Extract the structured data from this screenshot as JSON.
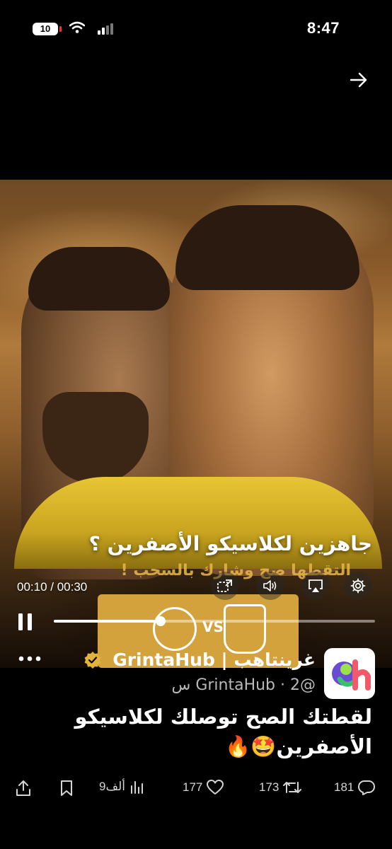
{
  "status_bar": {
    "battery": "10",
    "time": "8:47"
  },
  "media": {
    "headline": "جاهزين لكلاسيكو الأصفرين ؟",
    "subheadline": "التقطها صح وشارك بالسحب !",
    "ticket": {
      "vs": "VS"
    },
    "video": {
      "time_label": "00:10 / 00:30",
      "progress_fraction": 0.333
    }
  },
  "tweet": {
    "display_name": "غرينتاهب | GrintaHub",
    "handle_line": "@GrintaHub · 2 س",
    "text_line1": "لقطتك الصح توصلك لكلاسيكو",
    "text_line2": "الأصفرين🤩🔥",
    "actions": {
      "replies": "181",
      "reposts": "173",
      "likes": "177",
      "views": "9ألف"
    }
  },
  "icons": {
    "share_arrow": "arrow-right-icon",
    "more": "more-dots-icon",
    "verified": "verified-badge-icon",
    "reply": "reply-icon",
    "repost": "repost-icon",
    "like": "heart-icon",
    "views": "views-icon",
    "bookmark": "bookmark-icon",
    "share": "share-icon"
  },
  "colors": {
    "background": "#000000",
    "verified_badge": "#e2b33a",
    "secondary_text": "#b9b9b9"
  }
}
